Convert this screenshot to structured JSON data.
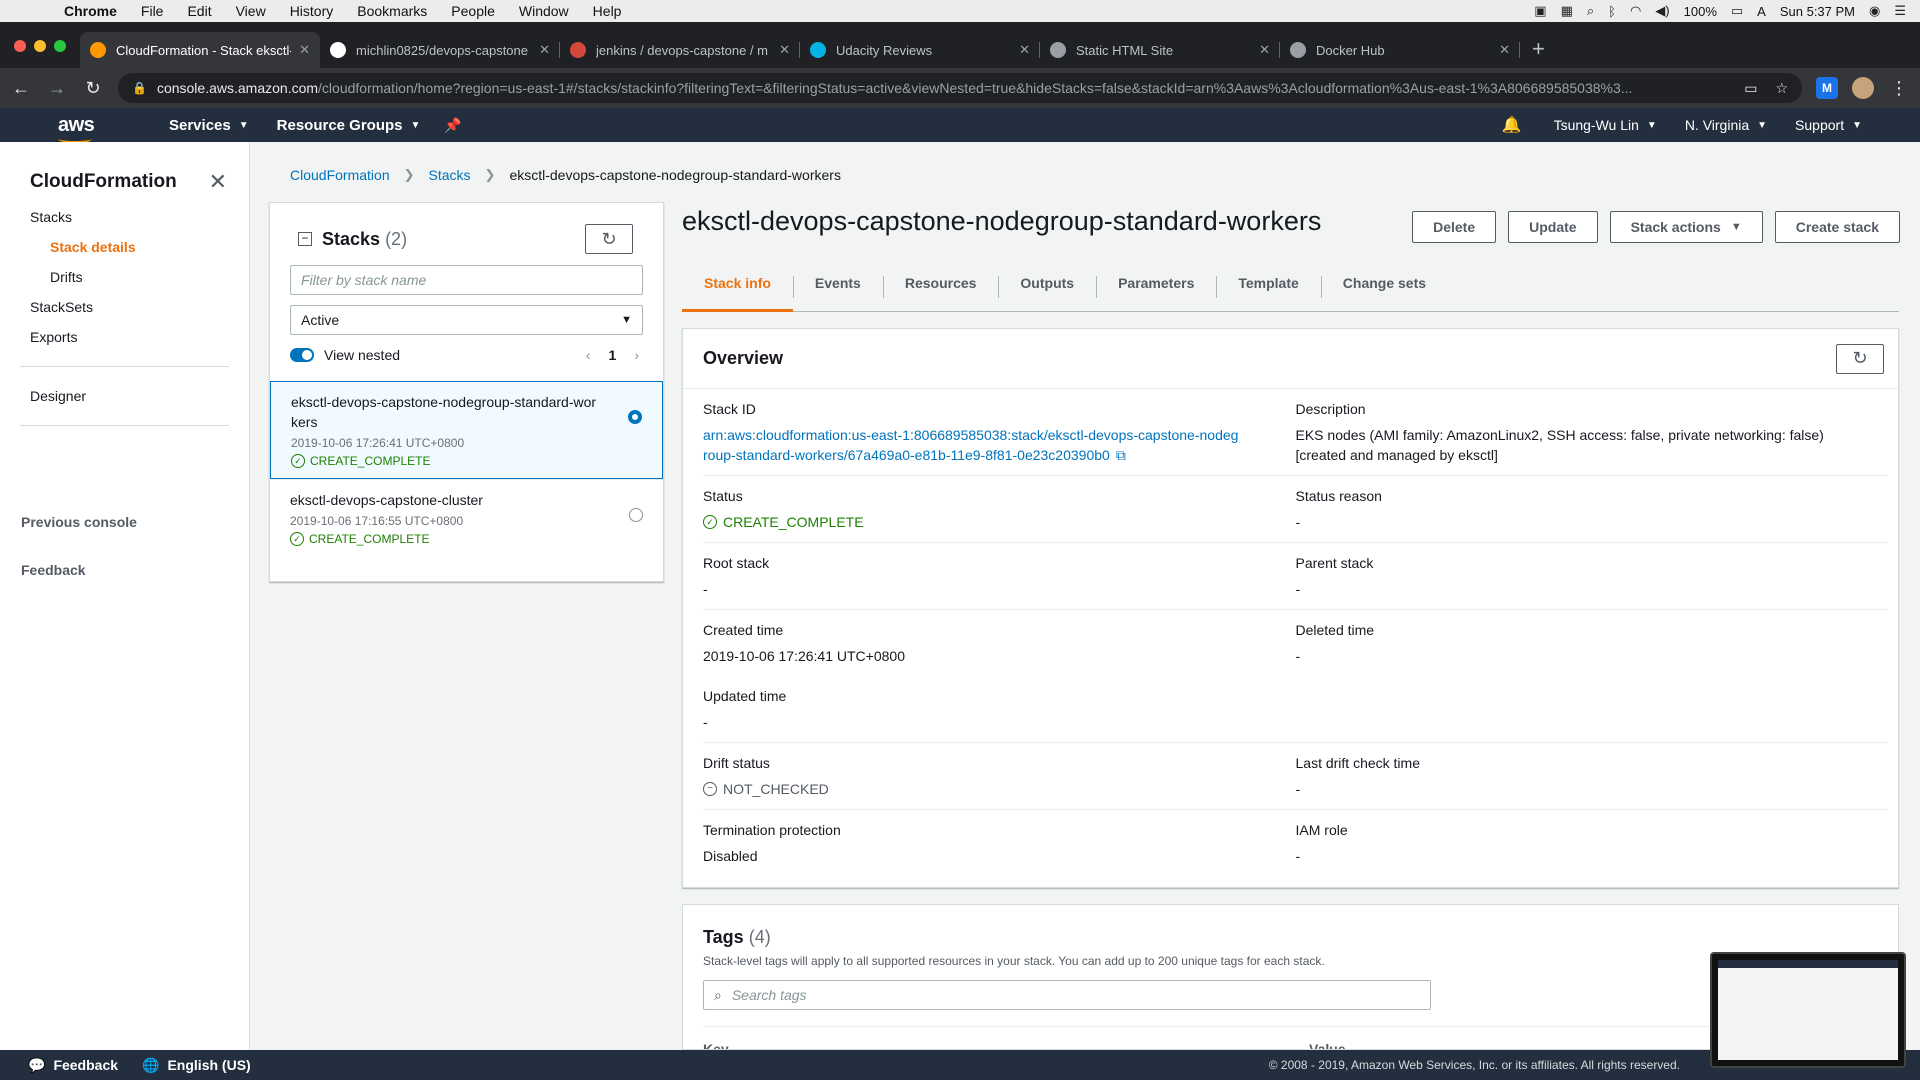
{
  "mac": {
    "menus": [
      "Chrome",
      "File",
      "Edit",
      "View",
      "History",
      "Bookmarks",
      "People",
      "Window",
      "Help"
    ],
    "battery": "100%",
    "input": "A",
    "clock": "Sun 5:37 PM"
  },
  "browser": {
    "tabs": [
      {
        "title": "CloudFormation - Stack eksctl-",
        "active": true,
        "favicon_color": "#ff9900"
      },
      {
        "title": "michlin0825/devops-capstone",
        "active": false,
        "favicon_color": "#ffffff"
      },
      {
        "title": "jenkins / devops-capstone / m",
        "active": false,
        "favicon_color": "#d24939"
      },
      {
        "title": "Udacity Reviews",
        "active": false,
        "favicon_color": "#02b3e4"
      },
      {
        "title": "Static HTML Site",
        "active": false,
        "favicon_color": "#9aa0a6"
      },
      {
        "title": "Docker Hub",
        "active": false,
        "favicon_color": "#9aa0a6"
      }
    ],
    "url_host": "console.aws.amazon.com",
    "url_path": "/cloudformation/home?region=us-east-1#/stacks/stackinfo?filteringText=&filteringStatus=active&viewNested=true&hideStacks=false&stackId=arn%3Aaws%3Acloudformation%3Aus-east-1%3A806689585038%3..."
  },
  "aws": {
    "logo": "aws",
    "services": "Services",
    "resource_groups": "Resource Groups",
    "user": "Tsung-Wu Lin",
    "region": "N. Virginia",
    "support": "Support"
  },
  "sidebar": {
    "title": "CloudFormation",
    "items": [
      {
        "label": "Stacks",
        "sub": false,
        "selected": false
      },
      {
        "label": "Stack details",
        "sub": true,
        "selected": true
      },
      {
        "label": "Drifts",
        "sub": true,
        "selected": false
      },
      {
        "label": "StackSets",
        "sub": false,
        "selected": false
      },
      {
        "label": "Exports",
        "sub": false,
        "selected": false
      }
    ],
    "designer": "Designer",
    "previous_console": "Previous console",
    "feedback": "Feedback"
  },
  "breadcrumb": [
    "CloudFormation",
    "Stacks",
    "eksctl-devops-capstone-nodegroup-standard-workers"
  ],
  "stacks_panel": {
    "title": "Stacks",
    "count": "(2)",
    "filter_placeholder": "Filter by stack name",
    "status_filter": "Active",
    "view_nested": "View nested",
    "page": "1",
    "items": [
      {
        "name": "eksctl-devops-capstone-nodegroup-standard-workers",
        "date": "2019-10-06 17:26:41 UTC+0800",
        "status": "CREATE_COMPLETE",
        "selected": true
      },
      {
        "name": "eksctl-devops-capstone-cluster",
        "date": "2019-10-06 17:16:55 UTC+0800",
        "status": "CREATE_COMPLETE",
        "selected": false
      }
    ]
  },
  "detail": {
    "title": "eksctl-devops-capstone-nodegroup-standard-workers",
    "actions": {
      "delete": "Delete",
      "update": "Update",
      "stack_actions": "Stack actions",
      "create": "Create stack"
    },
    "tabs": [
      "Stack info",
      "Events",
      "Resources",
      "Outputs",
      "Parameters",
      "Template",
      "Change sets"
    ],
    "overview_title": "Overview",
    "rows": [
      [
        {
          "label": "Stack ID",
          "value": "arn:aws:cloudformation:us-east-1:806689585038:stack/eksctl-devops-capstone-nodegroup-standard-workers/67a469a0-e81b-11e9-8f81-0e23c20390b0",
          "kind": "link"
        },
        {
          "label": "Description",
          "value": "EKS nodes (AMI family: AmazonLinux2, SSH access: false, private networking: false) [created and managed by eksctl]",
          "kind": "text"
        }
      ],
      [
        {
          "label": "Status",
          "value": "CREATE_COMPLETE",
          "kind": "ok"
        },
        {
          "label": "Status reason",
          "value": "-",
          "kind": "text"
        }
      ],
      [
        {
          "label": "Root stack",
          "value": "-",
          "kind": "text"
        },
        {
          "label": "Parent stack",
          "value": "-",
          "kind": "text"
        }
      ],
      [
        {
          "label": "Created time",
          "value": "2019-10-06 17:26:41 UTC+0800",
          "kind": "text"
        },
        {
          "label": "Deleted time",
          "value": "-",
          "kind": "text"
        }
      ],
      [
        {
          "label": "Updated time",
          "value": "-",
          "kind": "text"
        },
        {
          "label": "",
          "value": "",
          "kind": "text"
        }
      ],
      [
        {
          "label": "Drift status",
          "value": "NOT_CHECKED",
          "kind": "nc"
        },
        {
          "label": "Last drift check time",
          "value": "-",
          "kind": "text"
        }
      ],
      [
        {
          "label": "Termination protection",
          "value": "Disabled",
          "kind": "text"
        },
        {
          "label": "IAM role",
          "value": "-",
          "kind": "text"
        }
      ]
    ]
  },
  "tags": {
    "title": "Tags",
    "count": "(4)",
    "description": "Stack-level tags will apply to all supported resources in your stack. You can add up to 200 unique tags for each stack.",
    "search_placeholder": "Search tags",
    "col_key": "Key",
    "col_value": "Value"
  },
  "footer": {
    "feedback": "Feedback",
    "language": "English (US)",
    "copyright": "© 2008 - 2019, Amazon Web Services, Inc. or its affiliates. All rights reserved."
  },
  "colors": {
    "aws_nav": "#232f3e",
    "accent": "#ec7211",
    "link": "#0073bb",
    "success": "#1d8102"
  }
}
